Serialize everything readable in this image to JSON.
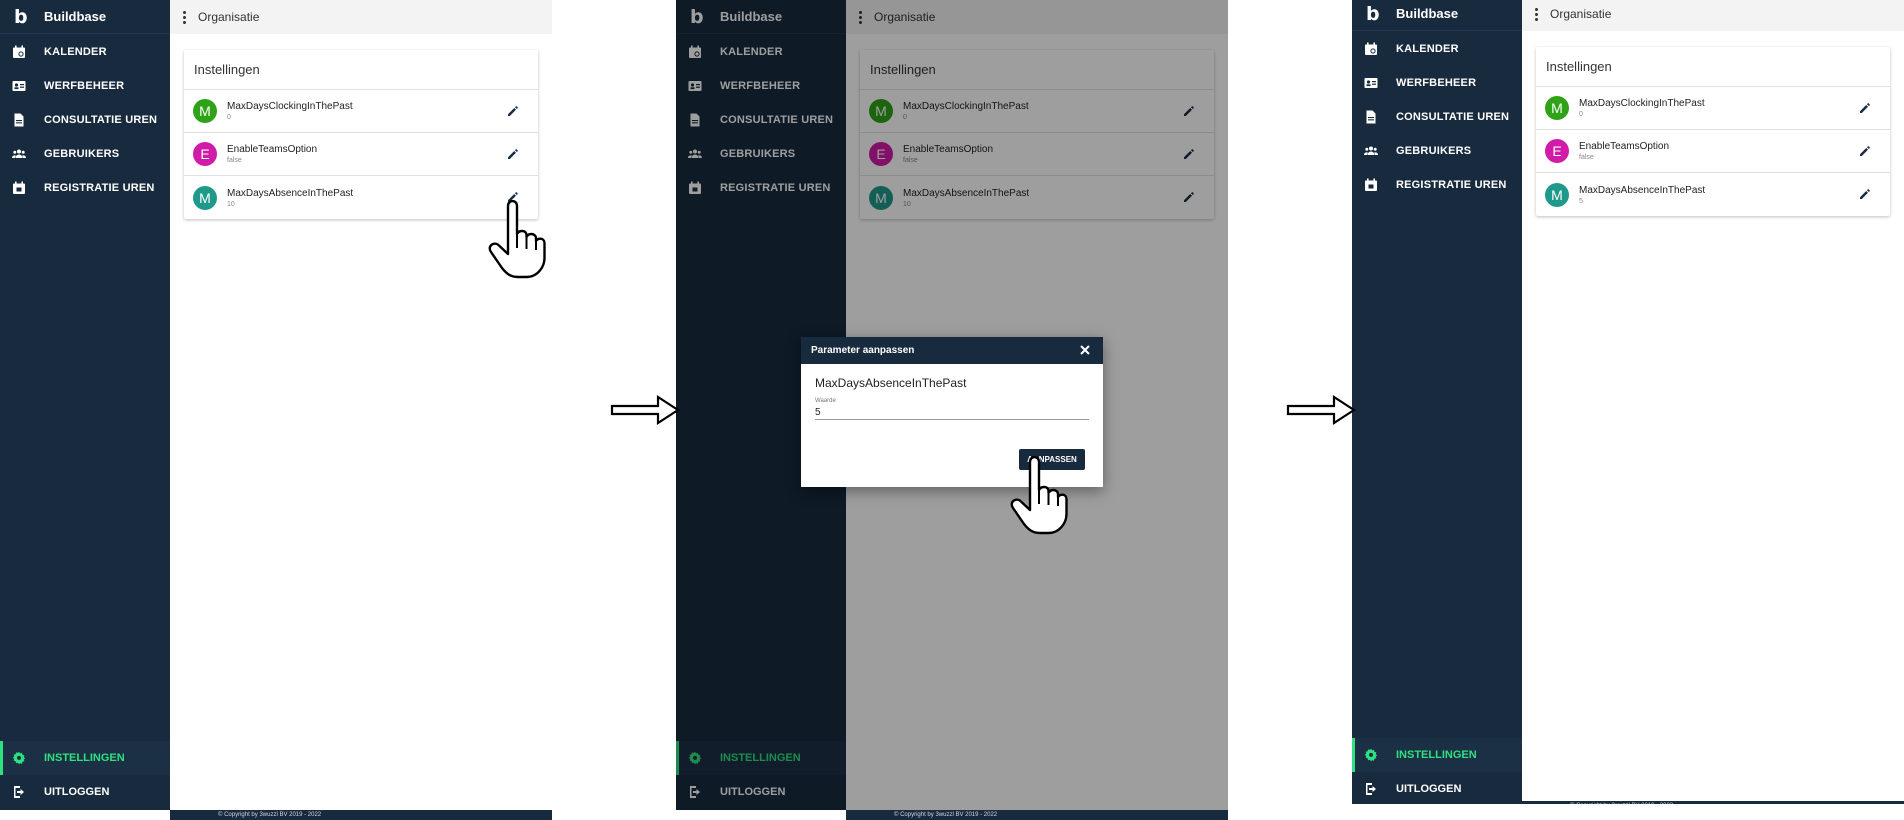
{
  "app": {
    "logo": "b",
    "name": "Buildbase"
  },
  "nav": [
    {
      "label": "KALENDER",
      "icon": "calendar-icon"
    },
    {
      "label": "WERFBEHEER",
      "icon": "id-card-icon"
    },
    {
      "label": "CONSULTATIE UREN",
      "icon": "document-icon"
    },
    {
      "label": "GEBRUIKERS",
      "icon": "users-icon"
    },
    {
      "label": "REGISTRATIE UREN",
      "icon": "calendar-check-icon"
    }
  ],
  "bottom_nav": [
    {
      "label": "INSTELLINGEN",
      "icon": "gear-icon",
      "active": true
    },
    {
      "label": "UITLOGGEN",
      "icon": "logout-icon",
      "active": false
    }
  ],
  "topbar": {
    "title": "Organisatie"
  },
  "card": {
    "title": "Instellingen"
  },
  "colors": {
    "sidebar": "#182a3e",
    "active": "#2fe07f",
    "avatar_m1": "#2ea318",
    "avatar_e": "#d11ba9",
    "avatar_m2": "#1f9a8a"
  },
  "panels": [
    {
      "settings": [
        {
          "letter": "M",
          "key": "MaxDaysClockingInThePast",
          "value": "0"
        },
        {
          "letter": "E",
          "key": "EnableTeamsOption",
          "value": "false"
        },
        {
          "letter": "M",
          "key": "MaxDaysAbsenceInThePast",
          "value": "10"
        }
      ]
    },
    {
      "settings": [
        {
          "letter": "M",
          "key": "MaxDaysClockingInThePast",
          "value": "0"
        },
        {
          "letter": "E",
          "key": "EnableTeamsOption",
          "value": "false"
        },
        {
          "letter": "M",
          "key": "MaxDaysAbsenceInThePast",
          "value": "10"
        }
      ]
    },
    {
      "settings": [
        {
          "letter": "M",
          "key": "MaxDaysClockingInThePast",
          "value": "0"
        },
        {
          "letter": "E",
          "key": "EnableTeamsOption",
          "value": "false"
        },
        {
          "letter": "M",
          "key": "MaxDaysAbsenceInThePast",
          "value": "5"
        }
      ]
    }
  ],
  "dialog": {
    "title": "Parameter aanpassen",
    "param_name": "MaxDaysAbsenceInThePast",
    "field_label": "Waarde",
    "field_value": "5",
    "button": "AANPASSEN"
  },
  "footer": {
    "text": "© Copyright by 3wuzzl BV 2019 - 2022"
  }
}
